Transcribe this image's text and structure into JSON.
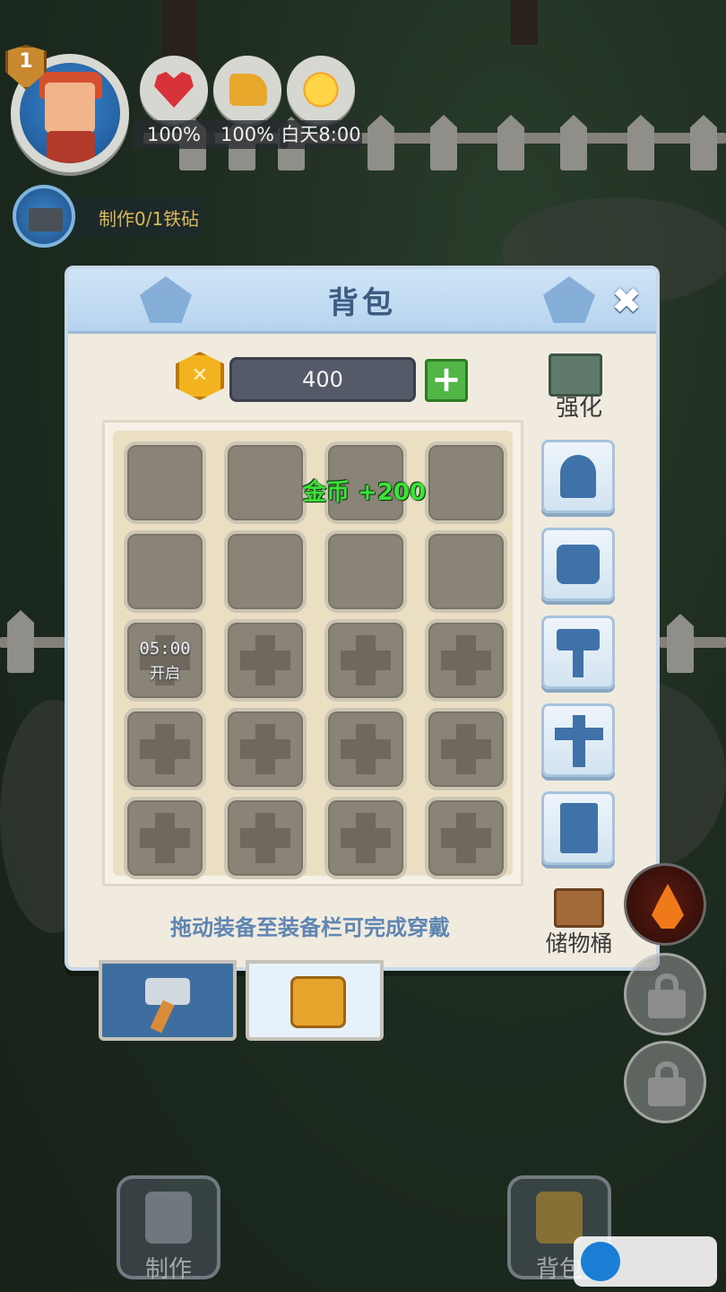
{
  "hud": {
    "level": "1",
    "health": "100%",
    "food": "100%",
    "time": "白天8:00",
    "craft_hint": "制作0/1铁砧"
  },
  "dialog": {
    "title": "背包",
    "gold": "400",
    "add_label": "+",
    "upgrade_label": "强化",
    "toast": "金币 +200",
    "timer": "05:00",
    "timer_action": "开启",
    "hint": "拖动装备至装备栏可完成穿戴",
    "storage_label": "储物桶",
    "close_symbol": "✖",
    "coin_symbol": "✕"
  },
  "grid": {
    "columns": 4,
    "rows": [
      [
        "empty",
        "empty",
        "empty",
        "empty"
      ],
      [
        "empty",
        "empty",
        "empty",
        "empty"
      ],
      [
        "timer",
        "locked",
        "locked",
        "locked"
      ],
      [
        "locked",
        "locked",
        "locked",
        "locked"
      ],
      [
        "locked",
        "locked",
        "locked",
        "locked"
      ]
    ]
  },
  "equipment_slots": [
    "helmet",
    "armor",
    "hammer",
    "sword",
    "book"
  ],
  "tabs": [
    {
      "name": "craft",
      "icon": "hammer-icon",
      "active": false
    },
    {
      "name": "bag",
      "icon": "backpack-icon",
      "active": true
    }
  ],
  "bottom_nav": {
    "craft_label": "制作",
    "bag_label": "背包"
  },
  "colors": {
    "header_blue": "#b6d3ee",
    "panel_cream": "#f1ebdf",
    "toast_green": "#3ee03c",
    "hint_blue": "#5f86b3",
    "gold": "#f3b31f"
  }
}
